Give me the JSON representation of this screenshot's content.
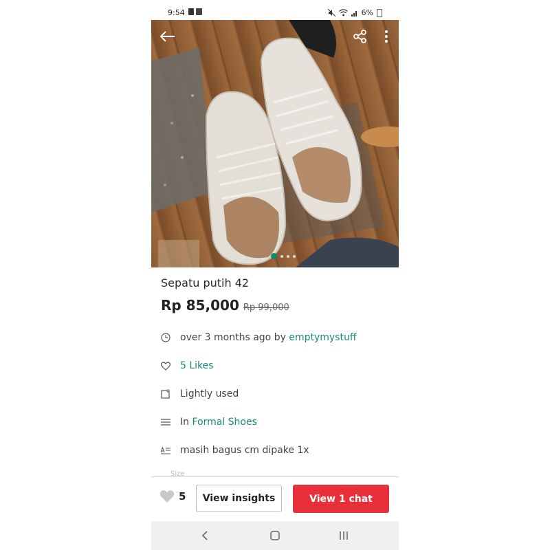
{
  "status_bar": {
    "time": "9:54",
    "battery": "6%"
  },
  "listing": {
    "title": "Sepatu putih 42",
    "price": "Rp 85,000",
    "original_price": "Rp 99,000",
    "posted_prefix": "over 3 months ago by ",
    "seller": "emptymystuff",
    "likes_text": "5 Likes",
    "condition": "Lightly used",
    "category_prefix": "In ",
    "category": "Formal Shoes",
    "description": "masih bagus cm dipake 1x",
    "next_field_label": "Size"
  },
  "gallery": {
    "image_count": 4,
    "active_index": 0
  },
  "actions": {
    "like_count": "5",
    "insights_label": "View insights",
    "chat_label": "View 1 chat"
  },
  "icons": {
    "back": "back-arrow-icon",
    "share": "share-icon",
    "more": "more-vertical-icon",
    "clock": "clock-icon",
    "heart": "heart-icon",
    "condition": "tag-icon",
    "category": "list-icon",
    "description": "text-icon"
  },
  "colors": {
    "accent": "#1a8a78",
    "chat_button": "#e8303a",
    "active_dot": "#0e8a6e"
  }
}
